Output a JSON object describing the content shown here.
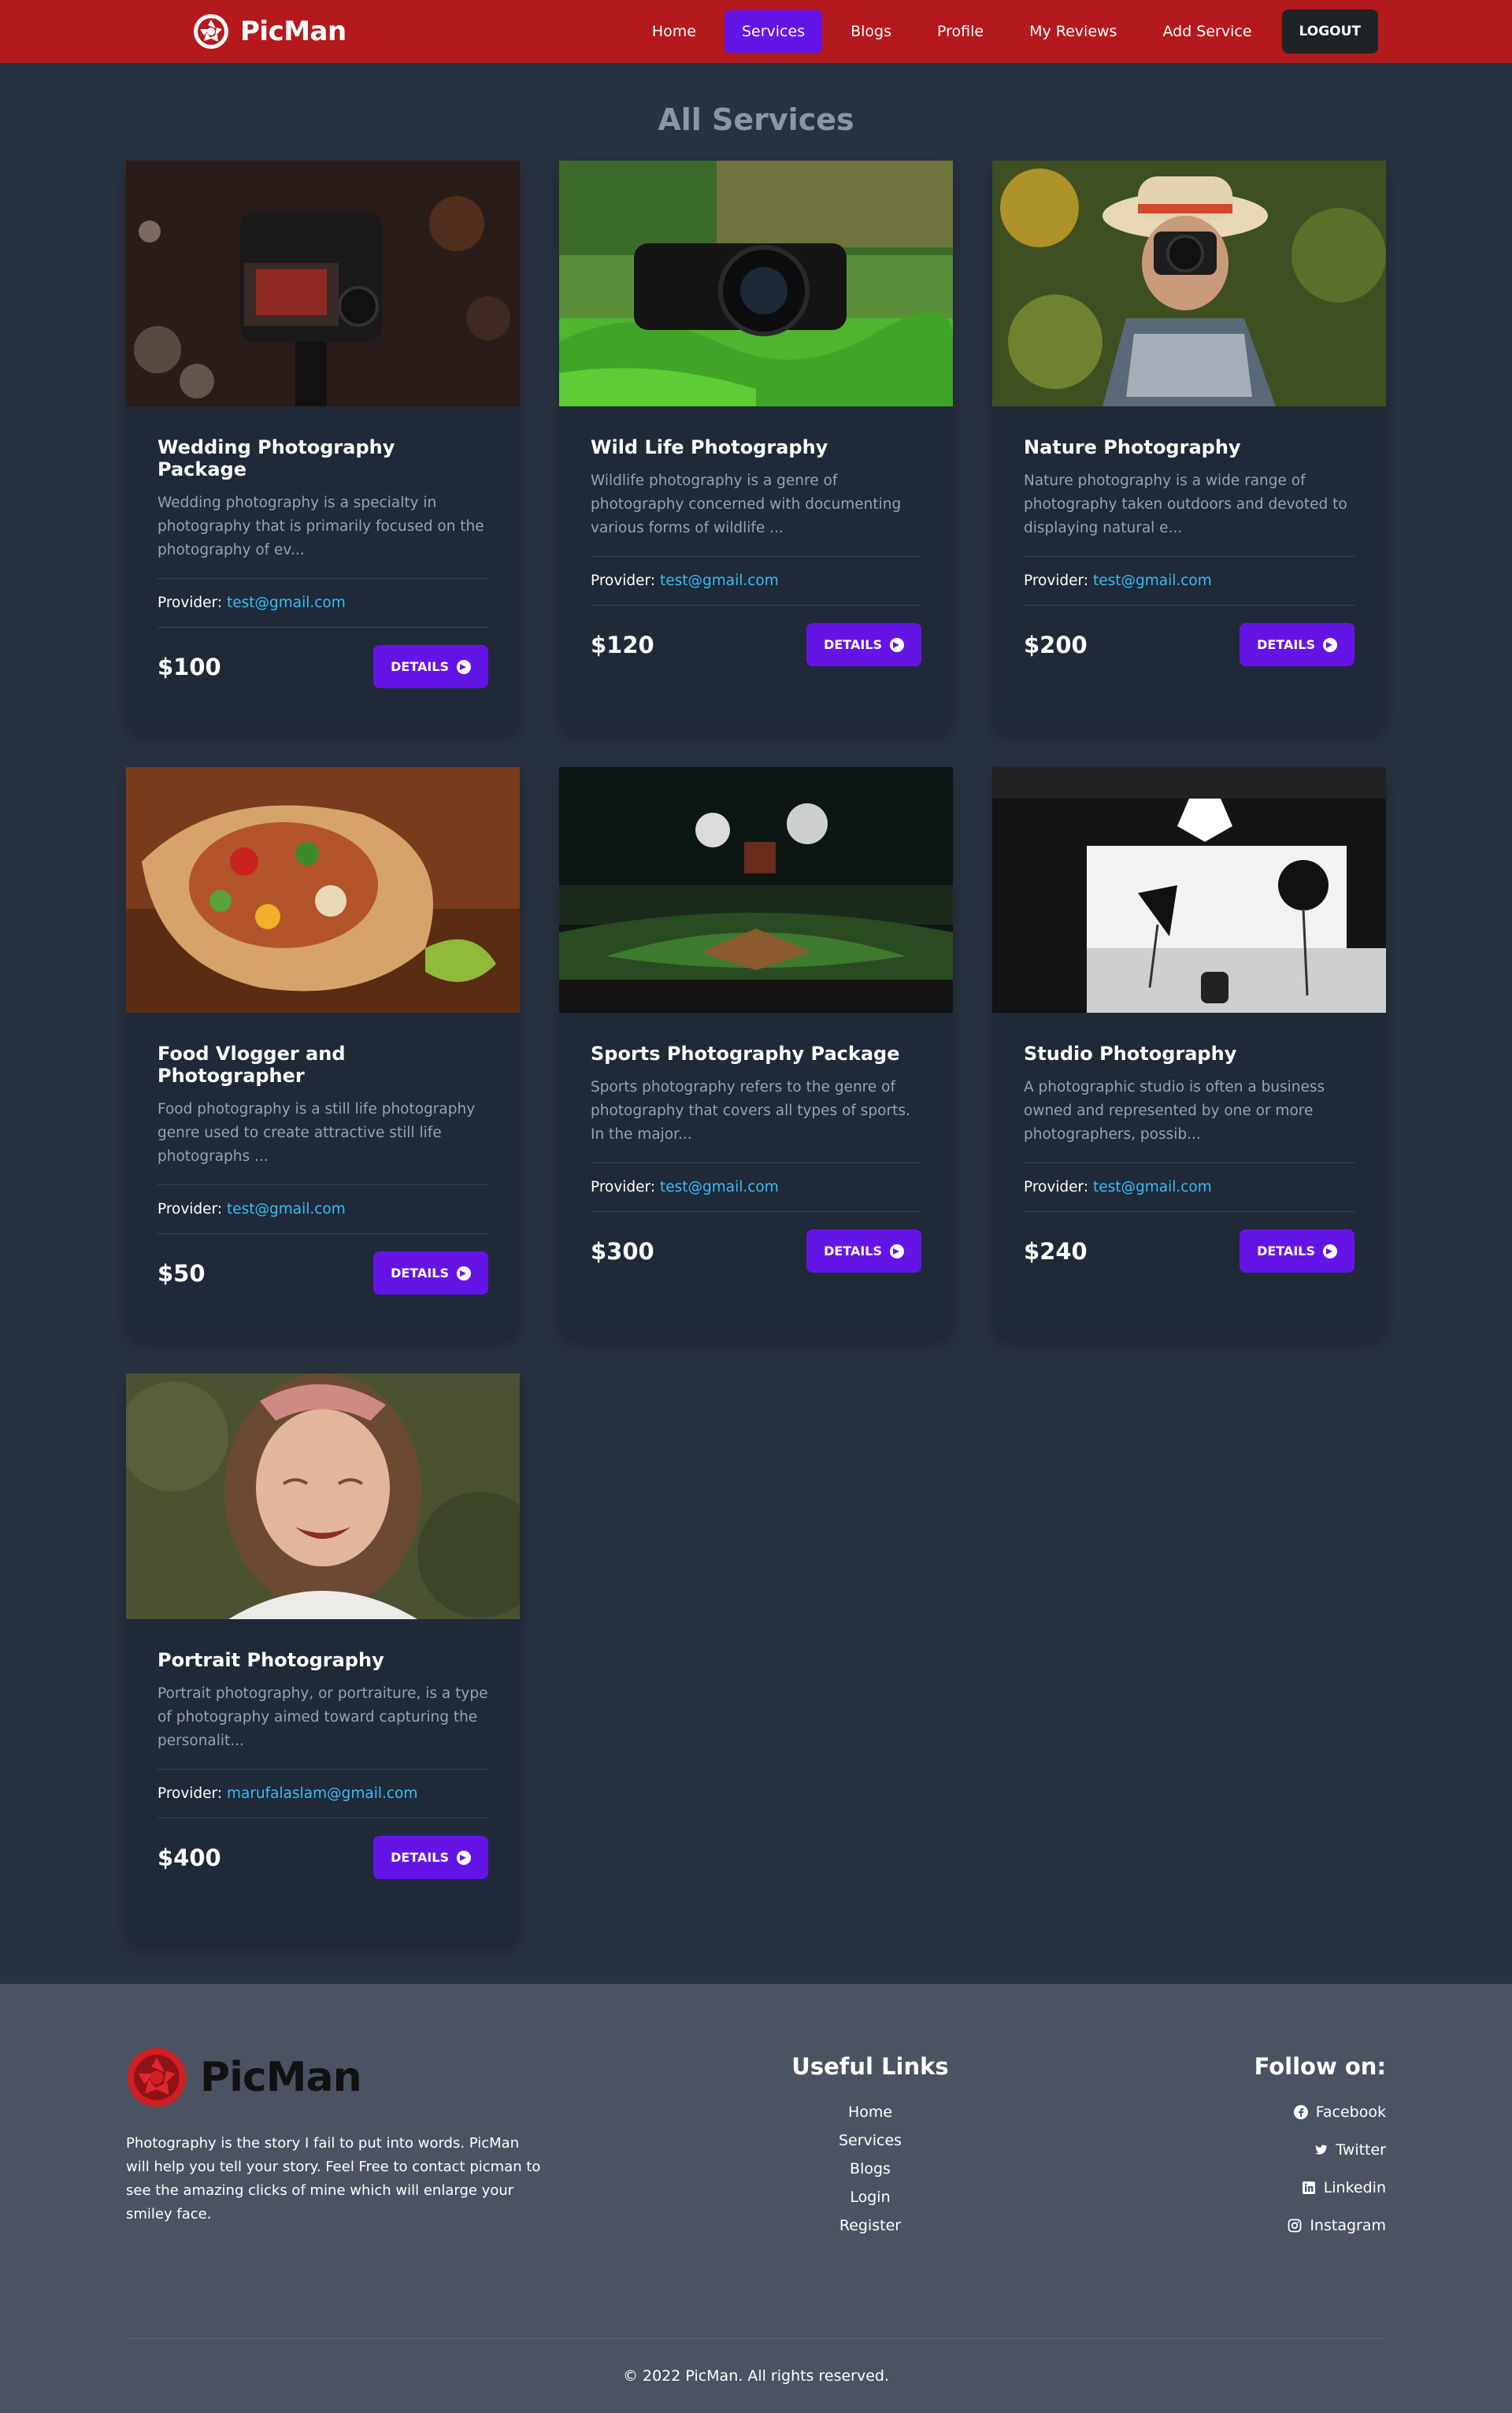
{
  "nav": {
    "brand": "PicMan",
    "links": [
      "Home",
      "Services",
      "Blogs",
      "Profile",
      "My Reviews",
      "Add Service"
    ],
    "logout": "LOGOUT"
  },
  "page_title": "All Services",
  "services": [
    {
      "title": "Wedding Photography Package",
      "desc": "Wedding photography is a specialty in photography that is primarily focused on the photography of ev...",
      "provider_label": "Provider:",
      "provider": "test@gmail.com",
      "price": "$100",
      "button": "DETAILS",
      "image": "camera-on-tripod-image"
    },
    {
      "title": "Wild Life Photography",
      "desc": "Wildlife photography is a genre of photography concerned with documenting various forms of wildlife ...",
      "provider_label": "Provider:",
      "provider": "test@gmail.com",
      "price": "$120",
      "button": "DETAILS",
      "image": "camera-in-grass-image"
    },
    {
      "title": "Nature Photography",
      "desc": "Nature photography is a wide range of photography taken outdoors and devoted to displaying natural e...",
      "provider_label": "Provider:",
      "provider": "test@gmail.com",
      "price": "$200",
      "button": "DETAILS",
      "image": "woman-photographer-image"
    },
    {
      "title": "Food Vlogger and Photographer",
      "desc": "Food photography is a still life photography genre used to create attractive still life photographs ...",
      "provider_label": "Provider:",
      "provider": "test@gmail.com",
      "price": "$50",
      "button": "DETAILS",
      "image": "burrito-image"
    },
    {
      "title": "Sports Photography Package",
      "desc": "Sports photography refers to the genre of photography that covers all types of sports. In the major...",
      "provider_label": "Provider:",
      "provider": "test@gmail.com",
      "price": "$300",
      "button": "DETAILS",
      "image": "stadium-image"
    },
    {
      "title": "Studio Photography",
      "desc": "A photographic studio is often a business owned and represented by one or more photographers, possib...",
      "provider_label": "Provider:",
      "provider": "test@gmail.com",
      "price": "$240",
      "button": "DETAILS",
      "image": "photo-studio-image"
    },
    {
      "title": "Portrait Photography",
      "desc": "Portrait photography, or portraiture, is a type of photography aimed toward capturing the personalit...",
      "provider_label": "Provider:",
      "provider": "marufalaslam@gmail.com",
      "price": "$400",
      "button": "DETAILS",
      "image": "girl-portrait-image"
    }
  ],
  "footer": {
    "brand": "PicMan",
    "about": "Photography is the story I fail to put into words. PicMan will help you tell your story. Feel Free to contact picman to see the amazing clicks of mine which will enlarge your smiley face.",
    "links_heading": "Useful Links",
    "links": [
      "Home",
      "Services",
      "Blogs",
      "Login",
      "Register"
    ],
    "follow_heading": "Follow on:",
    "social": [
      {
        "label": "Facebook",
        "icon": "facebook-icon"
      },
      {
        "label": "Twitter",
        "icon": "twitter-icon"
      },
      {
        "label": "Linkedin",
        "icon": "linkedin-icon"
      },
      {
        "label": "Instagram",
        "icon": "instagram-icon"
      }
    ],
    "copyright": "© 2022 PicMan. All rights reserved."
  },
  "colors": {
    "nav_bg": "#b4191d",
    "accent": "#6415e6",
    "page_bg": "#283140",
    "card_bg": "#1f2937",
    "footer_bg": "#4b5362",
    "link": "#38bdf8"
  }
}
